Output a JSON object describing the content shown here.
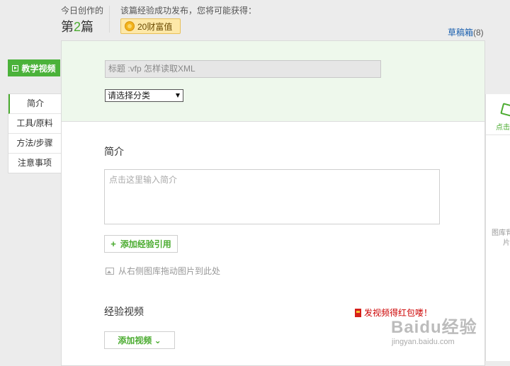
{
  "header": {
    "today_label": "今日创作的",
    "count_prefix": "第",
    "count_number": "2",
    "count_suffix": "篇",
    "publish_hint": "该篇经验成功发布，您将可能获得：",
    "reward": "20财富值",
    "drafts_label": "草稿箱",
    "drafts_count": "(8)"
  },
  "sidebar": {
    "video_tutorial": "教学视频",
    "items": [
      {
        "label": "简介"
      },
      {
        "label": "工具/原料"
      },
      {
        "label": "方法/步骤"
      },
      {
        "label": "注意事项"
      }
    ]
  },
  "form": {
    "title_value": "标题 :vfp 怎样读取XML",
    "category_value": "请选择分类",
    "intro_heading": "简介",
    "intro_placeholder": "点击这里输入简介",
    "add_reference": "添加经验引用",
    "drag_hint": "从右侧图库拖动图片到此处",
    "video_heading": "经验视频",
    "video_redpacket": "发视频得红包喽！",
    "add_video": "添加视频 ⌄"
  },
  "right_panel": {
    "upload_label": "点击",
    "library_hint": "图库背",
    "library_hint2": "片"
  },
  "watermark": {
    "logo": "Baidu经验",
    "url": "jingyan.baidu.com"
  },
  "colors": {
    "accent_green": "#4aab2f",
    "link_blue": "#1a5fae",
    "redpacket_red": "#cc0000"
  }
}
